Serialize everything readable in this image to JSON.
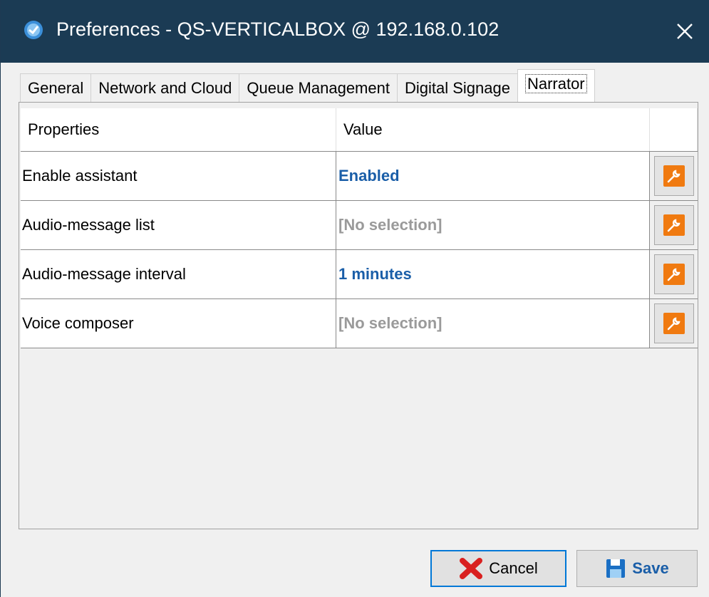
{
  "window": {
    "title": "Preferences - QS-VERTICALBOX @ 192.168.0.102",
    "close_symbol": "✕"
  },
  "tabs": [
    {
      "label": "General",
      "active": false
    },
    {
      "label": "Network and Cloud",
      "active": false
    },
    {
      "label": "Queue Management",
      "active": false
    },
    {
      "label": "Digital Signage",
      "active": false
    },
    {
      "label": "Narrator",
      "active": true
    }
  ],
  "table": {
    "headers": [
      "Properties",
      "Value",
      ""
    ],
    "rows": [
      {
        "property": "Enable assistant",
        "value": "Enabled",
        "state": "set"
      },
      {
        "property": "Audio-message list",
        "value": "[No selection]",
        "state": "none"
      },
      {
        "property": "Audio-message interval",
        "value": "1 minutes",
        "state": "set"
      },
      {
        "property": "Voice composer",
        "value": "[No selection]",
        "state": "none"
      }
    ]
  },
  "footer": {
    "cancel_label": "Cancel",
    "save_label": "Save"
  },
  "icons": {
    "app": "app-logo-icon",
    "close": "close-icon",
    "edit": "wrench-icon",
    "cancel": "red-x-icon",
    "save": "floppy-disk-icon"
  },
  "colors": {
    "titlebar": "#1b3b54",
    "value_set": "#1a5ea8",
    "value_none": "#9a9a9a",
    "edit_icon": "#f07a10",
    "cancel_icon": "#d9201f",
    "focus_border": "#0078d7"
  }
}
